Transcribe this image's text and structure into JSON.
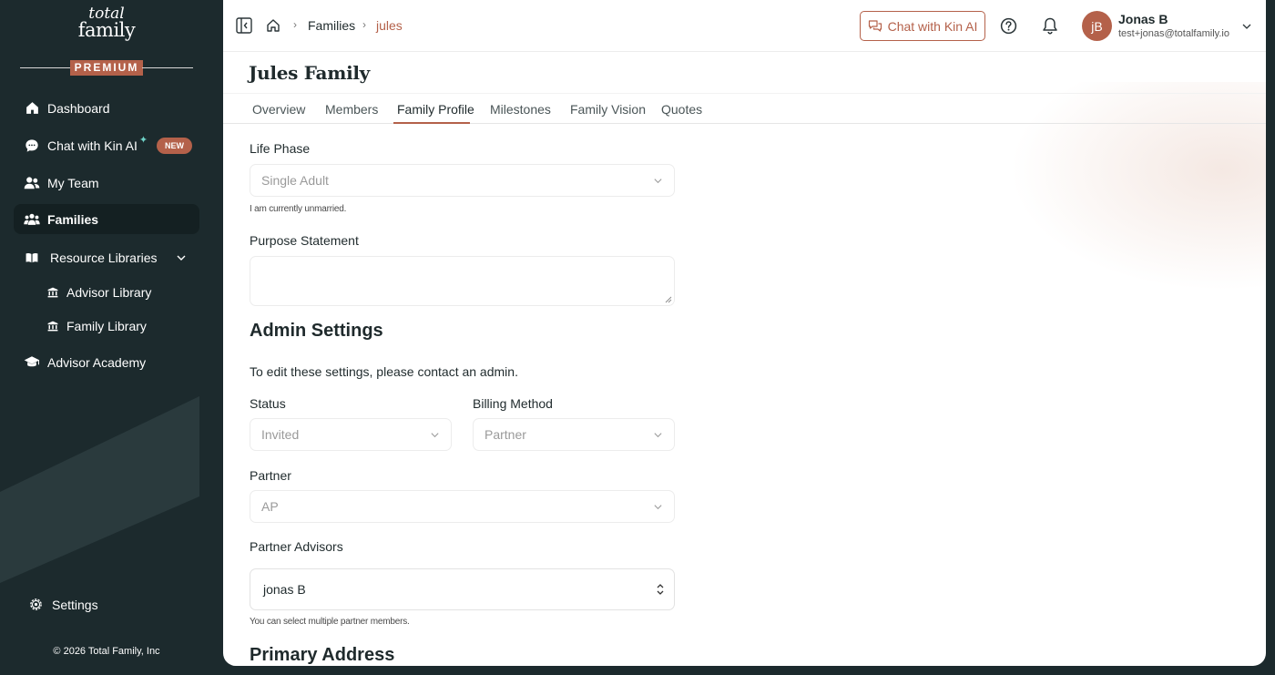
{
  "brand": {
    "logo_line1": "total",
    "logo_line2": "family",
    "tier": "PREMIUM",
    "accent": "#b4614a",
    "sidebar_bg": "#1c2a2d"
  },
  "sidebar": {
    "items": [
      {
        "label": "Dashboard",
        "icon": "home-icon"
      },
      {
        "label": "Chat with Kin AI",
        "icon": "chat-bubble-icon",
        "badge": "NEW",
        "sparkle": "✦"
      },
      {
        "label": "My Team",
        "icon": "team-icon"
      },
      {
        "label": "Families",
        "icon": "families-icon",
        "active": true
      },
      {
        "label": "Resource Libraries",
        "icon": "book-icon",
        "expanded": true
      },
      {
        "label": "Advisor Library",
        "icon": "library-icon"
      },
      {
        "label": "Family Library",
        "icon": "library-icon"
      },
      {
        "label": "Advisor Academy",
        "icon": "graduation-cap-icon"
      }
    ],
    "settings_label": "Settings",
    "copyright": "© 2026 Total Family, Inc"
  },
  "topbar": {
    "breadcrumb": [
      "Families",
      "jules"
    ],
    "chat_button": "Chat with Kin AI",
    "user": {
      "initials": "jB",
      "name": "Jonas B",
      "email": "test+jonas@totalfamily.io"
    }
  },
  "page": {
    "title": "Jules Family",
    "tabs": [
      "Overview",
      "Members",
      "Family Profile",
      "Milestones",
      "Family Vision",
      "Quotes"
    ],
    "active_tab": "Family Profile"
  },
  "form": {
    "life_phase": {
      "label": "Life Phase",
      "value": "Single Adult",
      "hint": "I am currently unmarried."
    },
    "purpose_statement": {
      "label": "Purpose Statement",
      "value": ""
    },
    "admin_settings": {
      "heading": "Admin Settings",
      "note": "To edit these settings, please contact an admin.",
      "status": {
        "label": "Status",
        "value": "Invited"
      },
      "billing_method": {
        "label": "Billing Method",
        "value": "Partner"
      },
      "partner": {
        "label": "Partner",
        "value": "AP"
      },
      "partner_advisors": {
        "label": "Partner Advisors",
        "value": "jonas B",
        "hint": "You can select multiple partner members."
      }
    },
    "primary_address_heading": "Primary Address"
  }
}
